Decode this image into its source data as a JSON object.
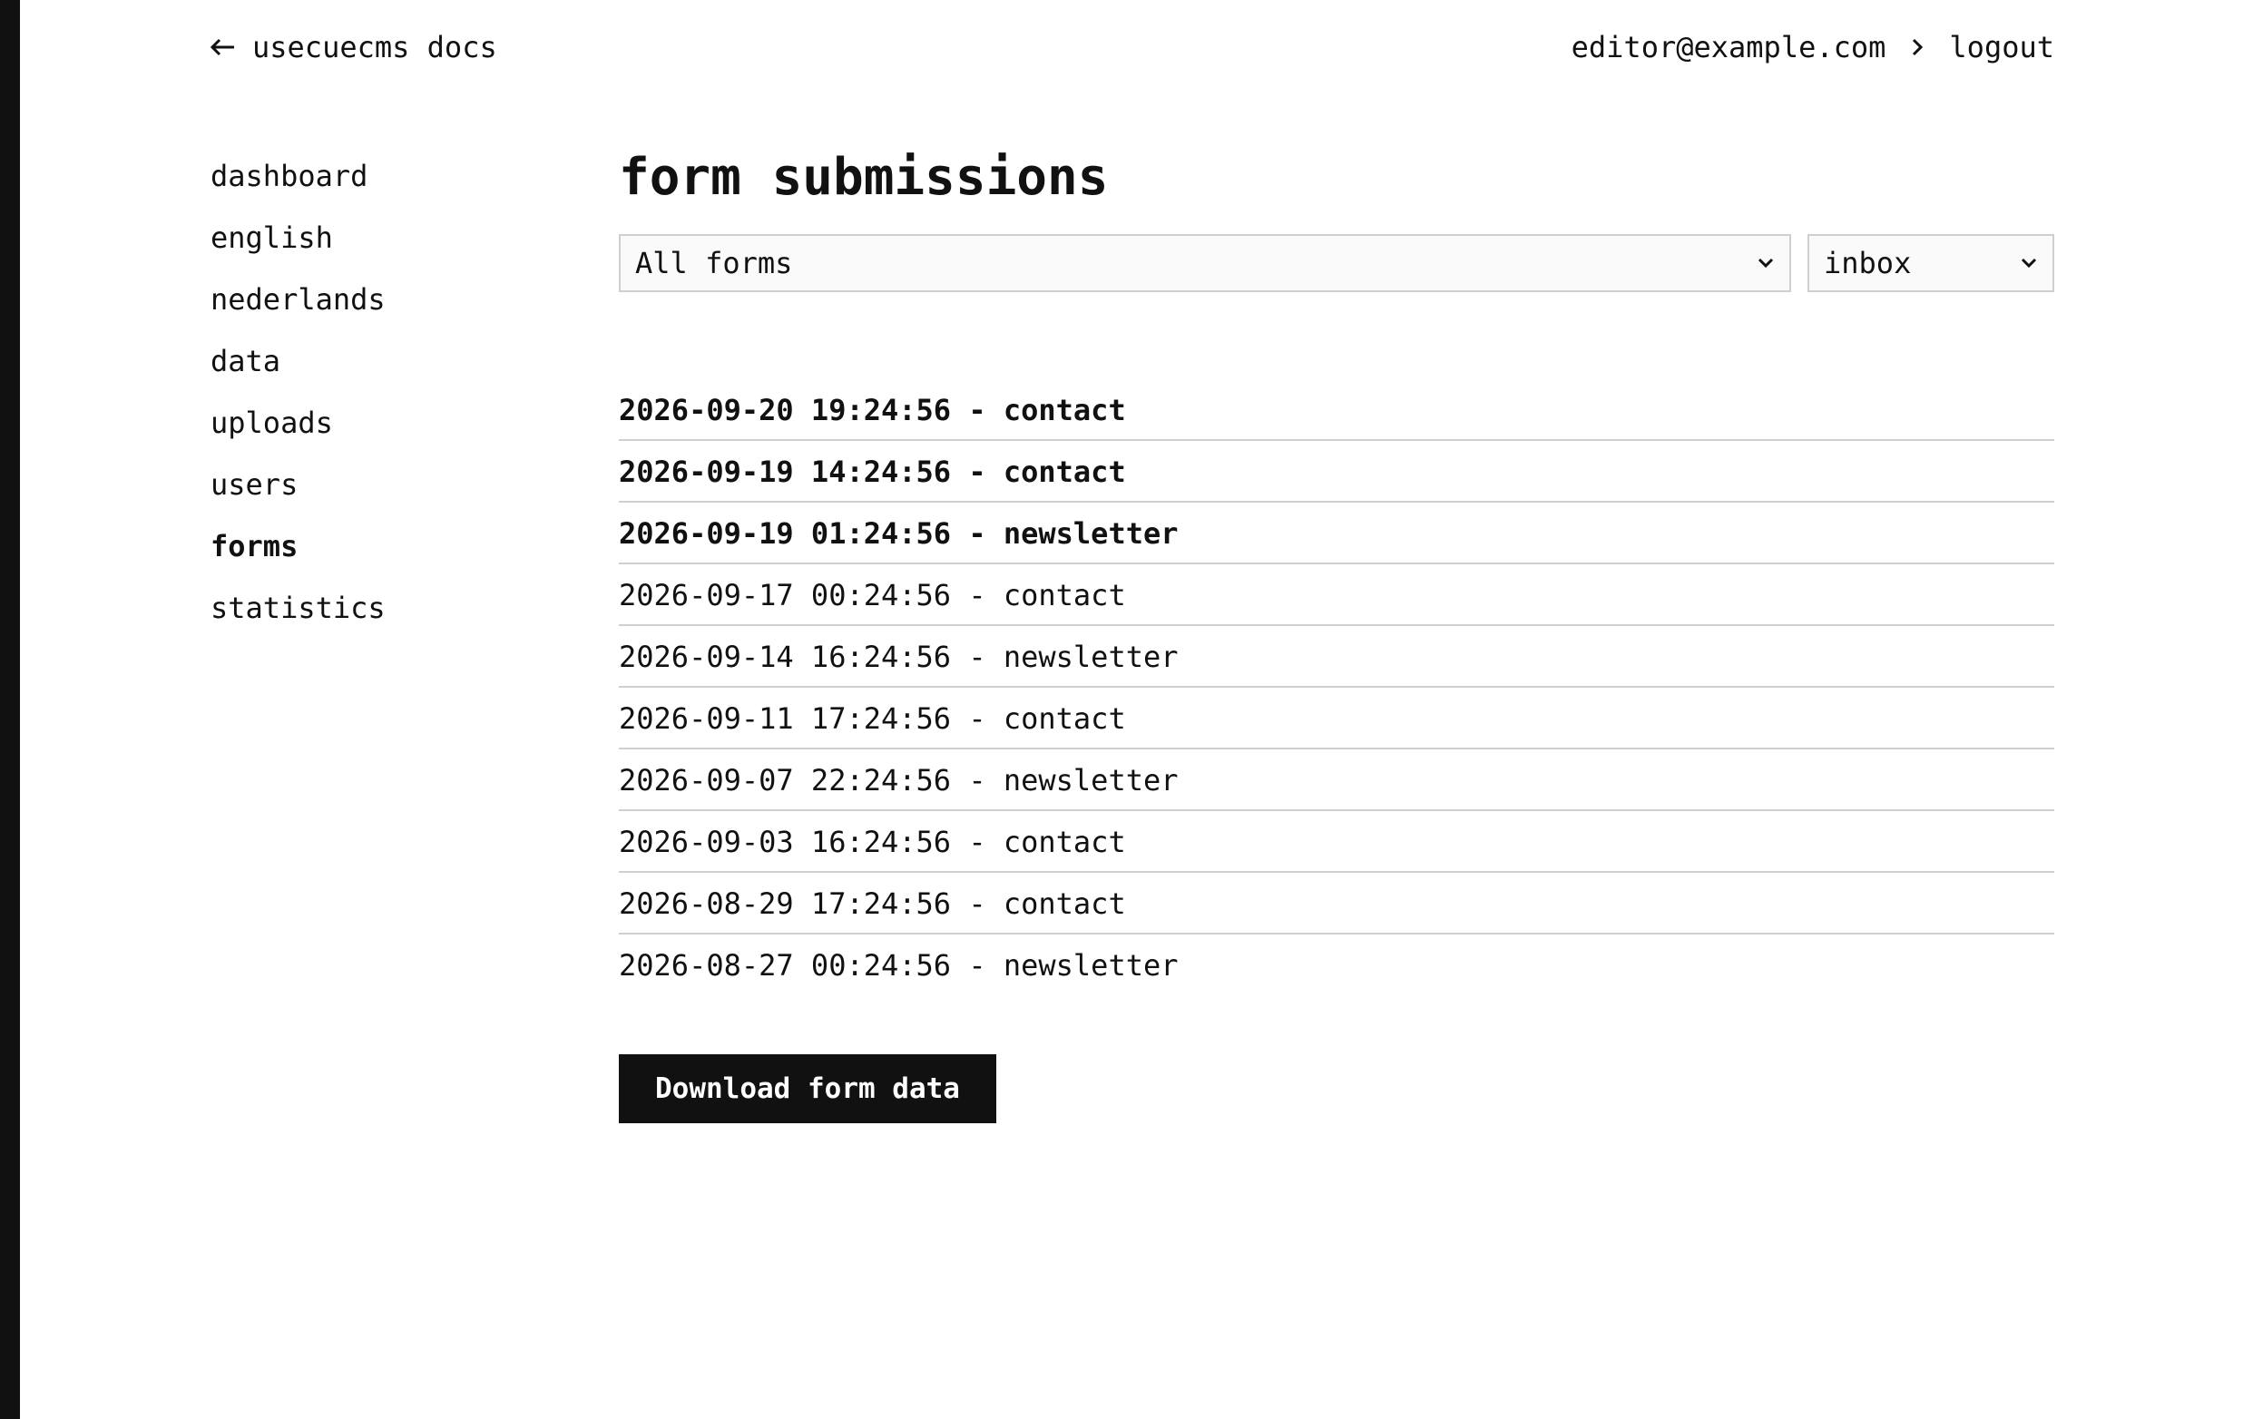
{
  "header": {
    "back_label": "usecuecms docs",
    "user_email": "editor@example.com",
    "logout_label": "logout"
  },
  "sidebar": {
    "items": [
      {
        "label": "dashboard"
      },
      {
        "label": "english"
      },
      {
        "label": "nederlands"
      },
      {
        "label": "data"
      },
      {
        "label": "uploads"
      },
      {
        "label": "users"
      },
      {
        "label": "forms",
        "active": true
      },
      {
        "label": "statistics"
      }
    ]
  },
  "main": {
    "title": "form submissions",
    "form_filter": {
      "selected": "All forms"
    },
    "status_filter": {
      "selected": "inbox"
    },
    "submissions": [
      {
        "label": "2026-09-20 19:24:56 - contact",
        "unread": true
      },
      {
        "label": "2026-09-19 14:24:56 - contact",
        "unread": true
      },
      {
        "label": "2026-09-19 01:24:56 - newsletter",
        "unread": true
      },
      {
        "label": "2026-09-17 00:24:56 - contact",
        "unread": false
      },
      {
        "label": "2026-09-14 16:24:56 - newsletter",
        "unread": false
      },
      {
        "label": "2026-09-11 17:24:56 - contact",
        "unread": false
      },
      {
        "label": "2026-09-07 22:24:56 - newsletter",
        "unread": false
      },
      {
        "label": "2026-09-03 16:24:56 - contact",
        "unread": false
      },
      {
        "label": "2026-08-29 17:24:56 - contact",
        "unread": false
      },
      {
        "label": "2026-08-27 00:24:56 - newsletter",
        "unread": false
      }
    ],
    "download_label": "Download form data"
  },
  "icons": {
    "back": "arrow-left-icon",
    "separator": "chevron-right-icon",
    "dropdown": "chevron-down-icon"
  },
  "colors": {
    "text": "#111111",
    "border": "#cfcfcf",
    "button_bg": "#111111",
    "button_text": "#ffffff"
  }
}
